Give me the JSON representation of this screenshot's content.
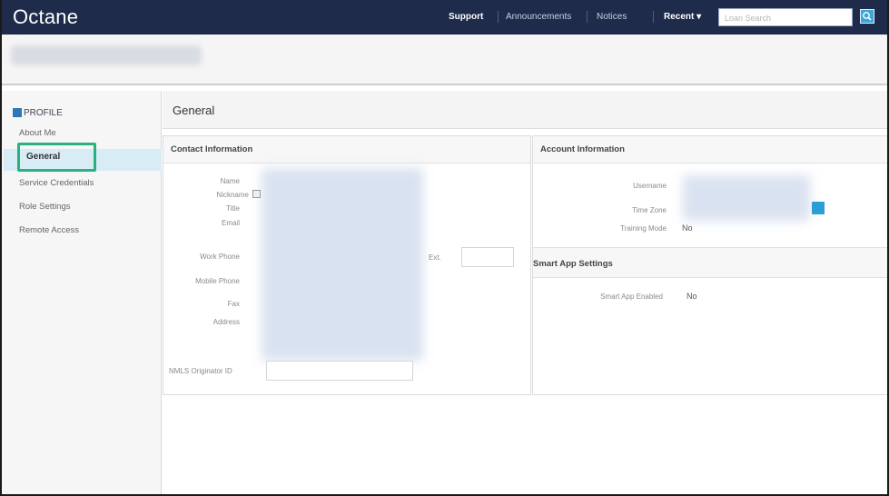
{
  "topbar": {
    "logo": "Octane",
    "support": "Support",
    "announcements": "Announcements",
    "notices": "Notices",
    "recent": "Recent ▾",
    "search_placeholder": "Loan Search",
    "brand_color": "#1e2b4a",
    "search_icon": "search-icon"
  },
  "sidebar": {
    "section": "PROFILE",
    "items": [
      {
        "label": "About Me"
      },
      {
        "label": "General",
        "selected": true
      },
      {
        "label": "Service Credentials"
      },
      {
        "label": "Role Settings"
      },
      {
        "label": "Remote Access"
      }
    ],
    "accent_color": "#29b17e"
  },
  "page": {
    "title": "General"
  },
  "contact": {
    "title": "Contact Information",
    "labels": {
      "name": "Name",
      "nickname": "Nickname",
      "title": "Title",
      "email": "Email",
      "work_phone": "Work Phone",
      "mobile_phone": "Mobile Phone",
      "fax": "Fax",
      "address": "Address",
      "ext": "Ext.",
      "nmls": "NMLS Originator ID"
    }
  },
  "account": {
    "title": "Account Information",
    "labels": {
      "username": "Username",
      "time_zone": "Time Zone",
      "training_mode": "Training Mode"
    },
    "training_mode_value": "No"
  },
  "smart_app": {
    "title": "Smart App Settings",
    "label": "Smart App Enabled",
    "value": "No"
  }
}
